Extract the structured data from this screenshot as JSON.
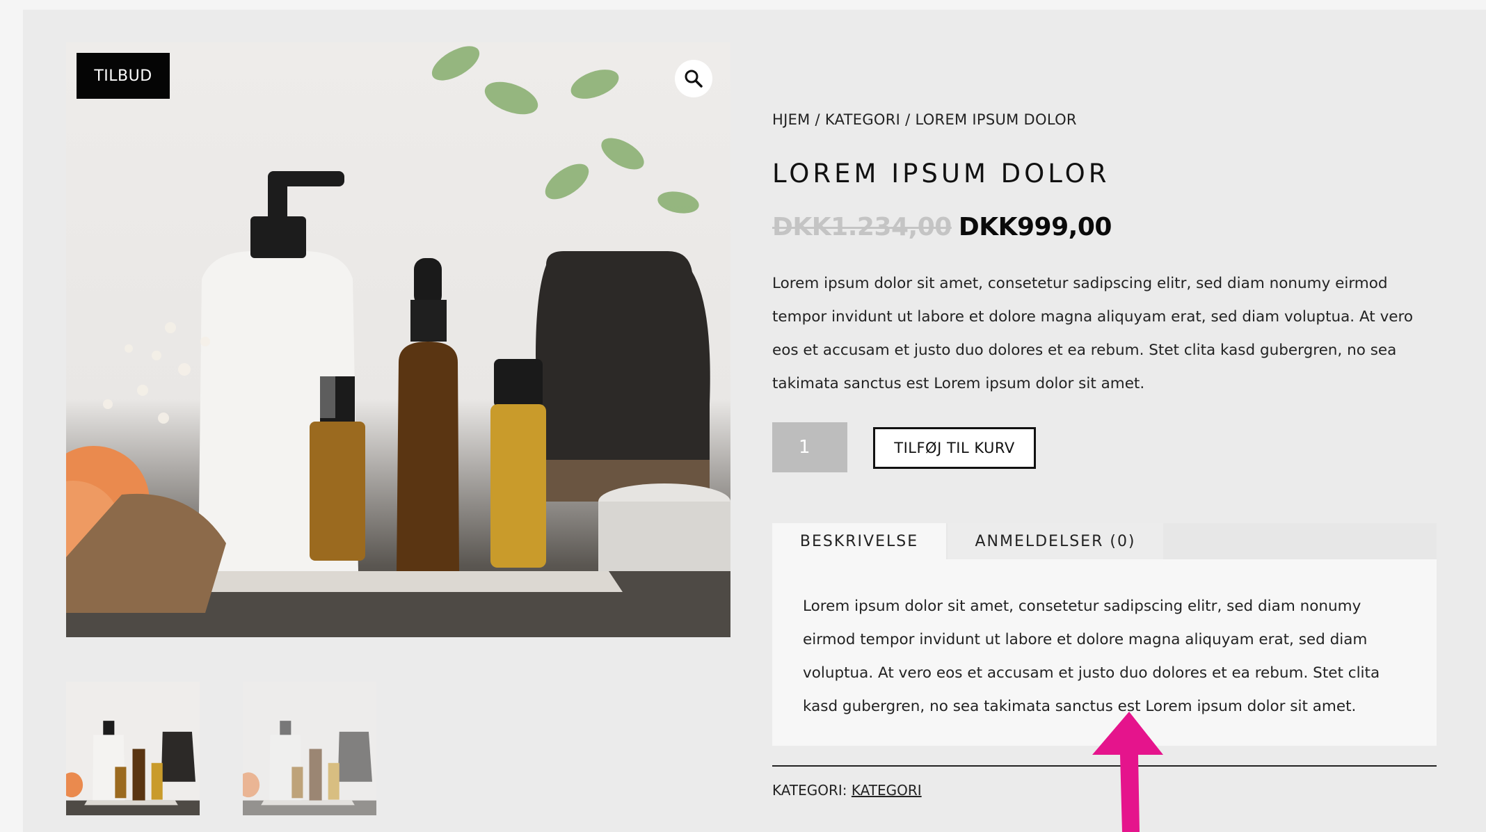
{
  "badge": {
    "label": "TILBUD"
  },
  "icons": {
    "zoom": "magnifier-icon"
  },
  "breadcrumb": {
    "items": [
      "HJEM",
      "KATEGORI",
      "LOREM IPSUM DOLOR"
    ],
    "separator": " / "
  },
  "product": {
    "title": "LOREM IPSUM DOLOR",
    "price_old": "DKK1.234,00",
    "price_new": "DKK999,00",
    "short_description": "Lorem ipsum dolor sit amet, consetetur sadipscing elitr, sed diam nonumy eirmod tempor invidunt ut labore et dolore magna aliquyam erat, sed diam voluptua. At vero eos et accusam et justo duo dolores et ea rebum. Stet clita kasd gubergren, no sea takimata sanctus est Lorem ipsum dolor sit amet.",
    "quantity": "1",
    "add_to_cart_label": "TILFØJ TIL KURV"
  },
  "tabs": {
    "items": [
      {
        "label": "BESKRIVELSE",
        "active": true
      },
      {
        "label": "ANMELDELSER (0)",
        "active": false
      }
    ],
    "panel_text": "Lorem ipsum dolor sit amet, consetetur sadipscing elitr, sed diam nonumy eirmod tempor invidunt ut labore et dolore magna aliquyam erat, sed diam voluptua. At vero eos et accusam et justo duo dolores et ea rebum. Stet clita kasd gubergren, no sea takimata sanctus est Lorem ipsum dolor sit amet."
  },
  "meta": {
    "category_prefix": "KATEGORI: ",
    "category_link": "KATEGORI"
  },
  "colors": {
    "annotation_arrow": "#e5148c",
    "badge_bg": "#050505",
    "old_price": "#c4c4c4"
  }
}
